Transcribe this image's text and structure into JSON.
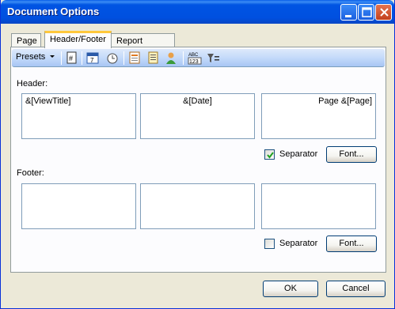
{
  "window": {
    "title": "Document Options"
  },
  "tabs": [
    {
      "label": "Page"
    },
    {
      "label": "Header/Footer"
    },
    {
      "label": "Report Content"
    }
  ],
  "toolbar": {
    "presets_label": "Presets"
  },
  "header": {
    "label": "Header:",
    "left": "&[ViewTitle]",
    "center": "&[Date]",
    "right": "Page &[Page]",
    "separator_label": "Separator",
    "separator_checked": true,
    "font_button": "Font..."
  },
  "footer": {
    "label": "Footer:",
    "left": "",
    "center": "",
    "right": "",
    "separator_label": "Separator",
    "separator_checked": false,
    "font_button": "Font..."
  },
  "buttons": {
    "ok": "OK",
    "cancel": "Cancel"
  },
  "colors": {
    "titlebar": "#0054e3",
    "dialog_bg": "#ece9d8",
    "active_tab_accent": "#ffc83c"
  }
}
